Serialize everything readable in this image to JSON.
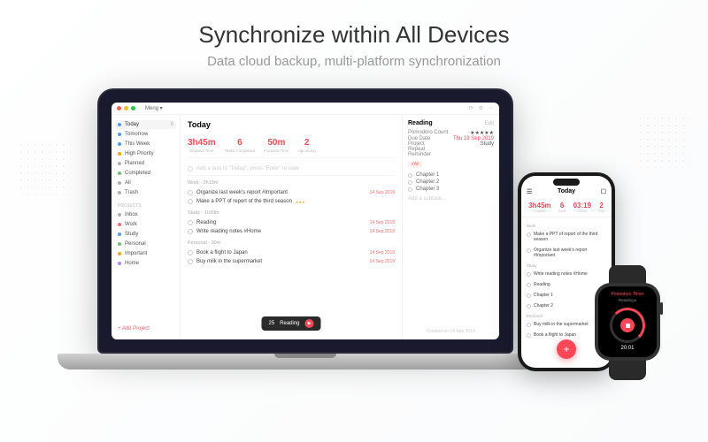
{
  "hero": {
    "title": "Synchronize within All Devices",
    "subtitle": "Data cloud backup, multi-platform synchronization"
  },
  "app": {
    "user": "Meng ▾",
    "toolbar": {
      "sync": "⟳",
      "settings": "⚙",
      "more": "⋯"
    },
    "sidebar": {
      "smart": [
        {
          "label": "Today",
          "count": "8",
          "color": "#4a9eff"
        },
        {
          "label": "Tomorrow",
          "count": "",
          "color": "#4a9eff"
        },
        {
          "label": "This Week",
          "count": "",
          "color": "#4a9eff"
        },
        {
          "label": "High Priority",
          "count": "",
          "color": "#ffa500"
        },
        {
          "label": "Planned",
          "count": "",
          "color": "#b0b0b0"
        },
        {
          "label": "Completed",
          "count": "",
          "color": "#6ac46a"
        },
        {
          "label": "All",
          "count": "",
          "color": "#b0b0b0"
        },
        {
          "label": "Trash",
          "count": "",
          "color": "#b0b0b0"
        }
      ],
      "projects_label": "PROJECTS",
      "projects": [
        {
          "label": "Inbox",
          "color": "#b0b0b0"
        },
        {
          "label": "Work",
          "color": "#ff6b6b"
        },
        {
          "label": "Study",
          "color": "#4a9eff"
        },
        {
          "label": "Personal",
          "color": "#6ac46a"
        },
        {
          "label": "Important",
          "color": "#ffa500"
        },
        {
          "label": "Home",
          "color": "#b483ff"
        }
      ],
      "add": "+ Add Project"
    },
    "main": {
      "title": "Today",
      "stats": [
        {
          "num": "3h45m",
          "lbl": "Elapsed Time"
        },
        {
          "num": "6",
          "lbl": "Tasks Completed"
        },
        {
          "num": "50m",
          "lbl": "Focused Time"
        },
        {
          "num": "2",
          "lbl": "Upcoming"
        }
      ],
      "placeholder": "Add a task to \"Today\", press \"Enter\" to save",
      "sections": [
        {
          "head": "Work · 2h10m",
          "tasks": [
            {
              "t": "Organize last week's report #Important",
              "d": "14 Sep 2019"
            },
            {
              "t": "Make a PPT of report of the third season",
              "d": "",
              "stars": "★★★"
            }
          ]
        },
        {
          "head": "Study · 1h50m",
          "tasks": [
            {
              "t": "Reading",
              "d": "14 Sep 2019"
            },
            {
              "t": "Write reading notes #Home",
              "d": "14 Sep 2019"
            }
          ]
        },
        {
          "head": "Personal · 30m",
          "tasks": [
            {
              "t": "Book a flight to Japan",
              "d": "14 Sep 2019"
            },
            {
              "t": "Buy milk in the supermarket",
              "d": "14 Sep 2019"
            }
          ]
        }
      ],
      "timer": {
        "count": "25",
        "label": "Reading",
        "icon": "▶"
      }
    },
    "detail": {
      "title": "Reading",
      "edit": "Edit",
      "rows": [
        {
          "k": "Pomodoro Count",
          "v": "★★★★★"
        },
        {
          "k": "Due Date",
          "v": "Thu 19 Sep 2019",
          "red": true
        },
        {
          "k": "Project",
          "v": "Study"
        },
        {
          "k": "Repeat",
          "v": ""
        },
        {
          "k": "Reminder",
          "v": ""
        }
      ],
      "tag": "#All",
      "subs": [
        {
          "t": "Chapter 1"
        },
        {
          "t": "Chapter 2"
        },
        {
          "t": "Chapter 3"
        }
      ],
      "add_sub": "Add a subtask...",
      "footer": "Created on 14 Sep 2019"
    }
  },
  "phone": {
    "title": "Today",
    "stats": [
      {
        "n": "3h45m",
        "l": "Elapsed"
      },
      {
        "n": "6",
        "l": "Done"
      },
      {
        "n": "03:19",
        "l": "Focus"
      },
      {
        "n": "2",
        "l": "Due"
      }
    ],
    "sec1": "Work",
    "tasks1": [
      {
        "t": "Make a PPT of report of the third season"
      },
      {
        "t": "Organize last week's report #Important"
      }
    ],
    "sec2": "Study",
    "tasks2": [
      {
        "t": "Write reading notes #Home"
      },
      {
        "t": "Reading"
      },
      {
        "t": "Chapter 1"
      },
      {
        "t": "Chapter 2"
      }
    ],
    "sec3": "Personal",
    "tasks3": [
      {
        "t": "Buy milk in the supermarket"
      },
      {
        "t": "Book a flight to Japan"
      }
    ],
    "fab": "+"
  },
  "watch": {
    "title": "Pomodoro Timer",
    "sub": "Reading ▸",
    "time": "20:01"
  }
}
